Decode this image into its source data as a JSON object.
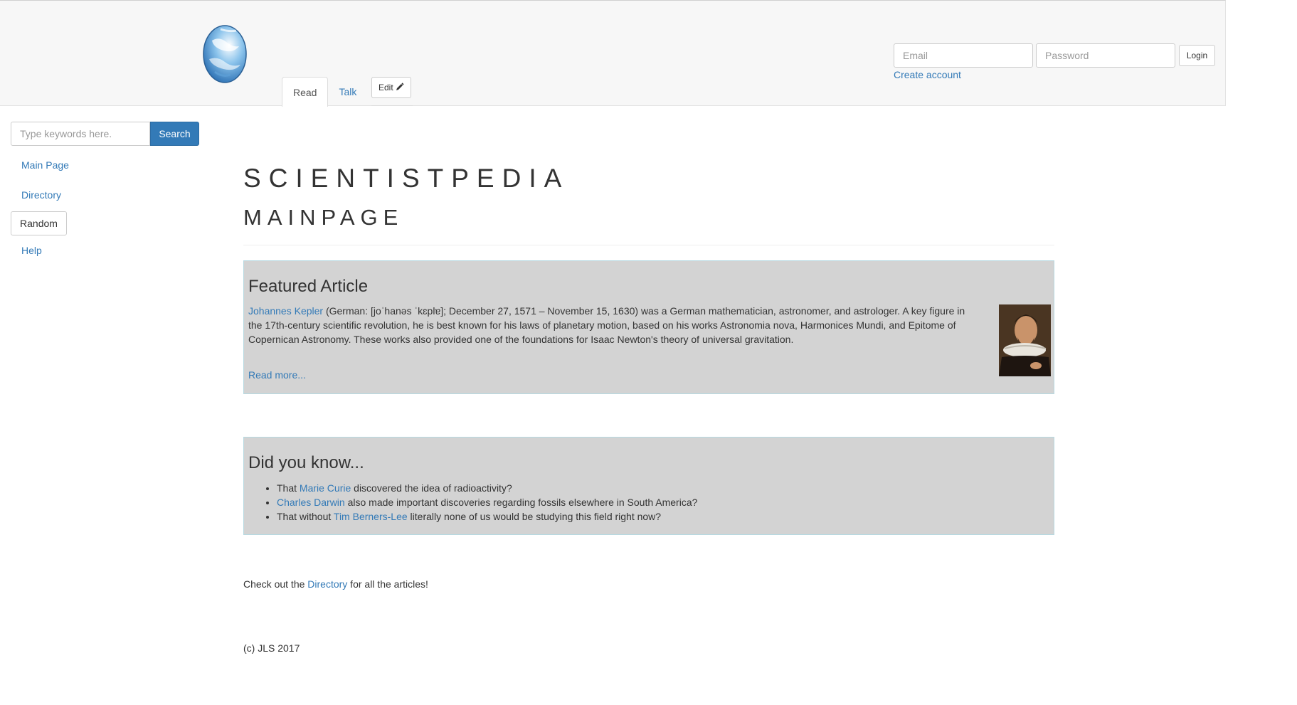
{
  "header": {
    "tabs": {
      "read": "Read",
      "talk": "Talk"
    },
    "edit_label": "Edit",
    "login": {
      "email_placeholder": "Email",
      "password_placeholder": "Password",
      "login_label": "Login",
      "create_account": "Create account"
    }
  },
  "sidebar": {
    "search_placeholder": "Type keywords here.",
    "search_button": "Search",
    "items": [
      {
        "label": "Main Page"
      },
      {
        "label": "Directory"
      },
      {
        "label": "Random"
      },
      {
        "label": "Help"
      }
    ]
  },
  "main": {
    "site_title": "SCIENTISTPEDIA",
    "page_title": "MAINPAGE",
    "featured": {
      "title": "Featured Article",
      "subject_link": "Johannes Kepler",
      "text": " (German: [joˈhanəs ˈkɛplɐ]; December 27, 1571 – November 15, 1630) was a German mathematician, astronomer, and astrologer. A key figure in the 17th-century scientific revolution, he is best known for his laws of planetary motion, based on his works Astronomia nova, Harmonices Mundi, and Epitome of Copernican Astronomy. These works also provided one of the foundations for Isaac Newton's theory of universal gravitation.",
      "read_more": "Read more..."
    },
    "did_you_know": {
      "title": "Did you know...",
      "items": [
        {
          "before": "That ",
          "link": "Marie Curie",
          "after": " discovered the idea of radioactivity?"
        },
        {
          "before": "",
          "link": "Charles Darwin",
          "after": " also made important discoveries regarding fossils elsewhere in South America?"
        },
        {
          "before": "That without ",
          "link": "Tim Berners-Lee",
          "after": " literally none of us would be studying this field right now?"
        }
      ]
    },
    "checkout": {
      "before": "Check out the ",
      "link": "Directory",
      "after": " for all the articles!"
    },
    "footer": "(c) JLS 2017"
  },
  "colors": {
    "link": "#337ab7",
    "primary_button": "#337ab7",
    "box_background": "#d3d3d3",
    "box_border": "#b6d9e1",
    "header_background": "#f7f7f7"
  },
  "icons": {
    "logo": "earth-globe-logo",
    "edit": "pencil-icon"
  }
}
